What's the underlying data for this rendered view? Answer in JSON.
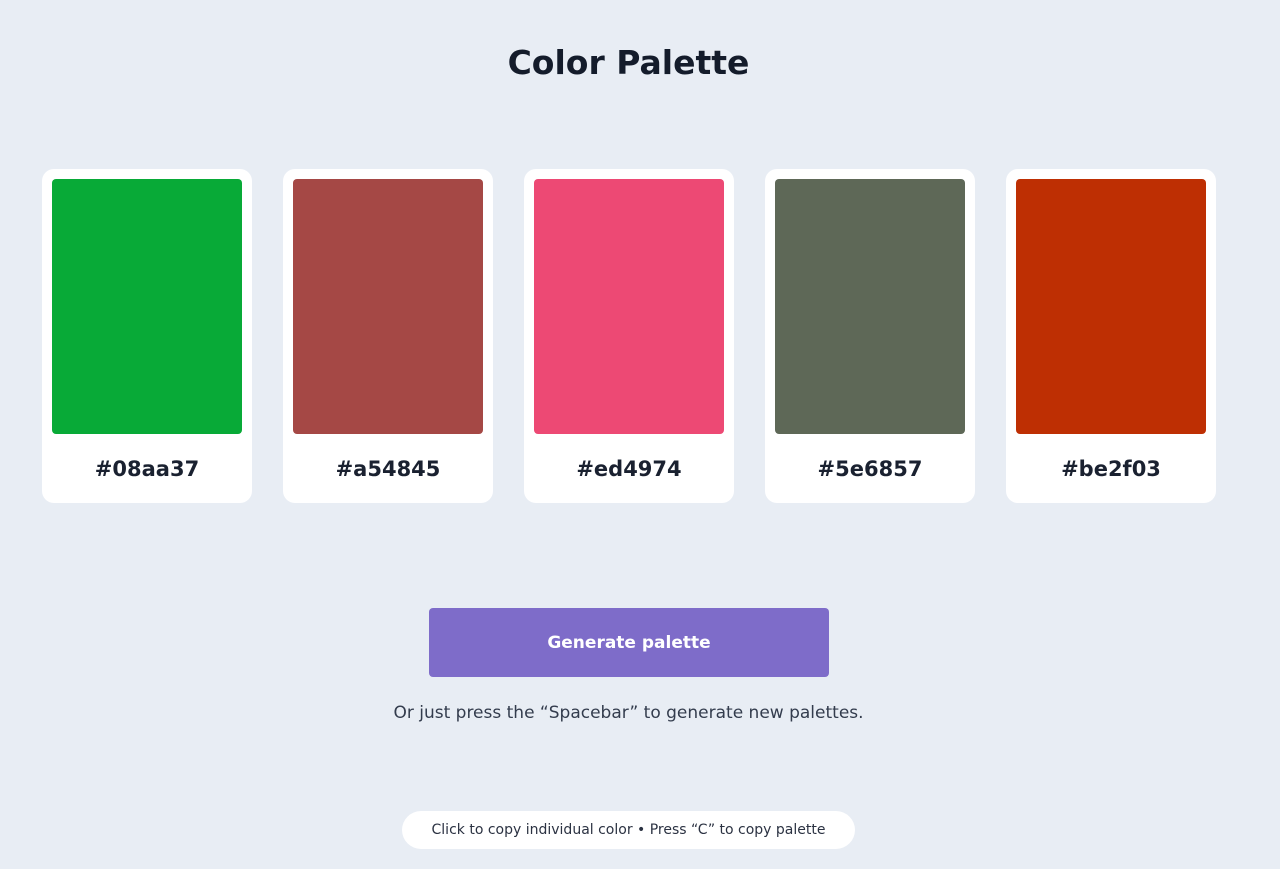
{
  "page": {
    "title": "Color Palette"
  },
  "palette": {
    "colors": [
      {
        "hex": "#08aa37"
      },
      {
        "hex": "#a54845"
      },
      {
        "hex": "#ed4974"
      },
      {
        "hex": "#5e6857"
      },
      {
        "hex": "#be2f03"
      }
    ]
  },
  "controls": {
    "generate_label": "Generate palette",
    "hint": "Or just press the “Spacebar” to generate new palettes."
  },
  "footer": {
    "tip": "Click to copy individual color • Press “C” to copy palette"
  },
  "theme": {
    "background": "#e8edf4",
    "button_color": "#7e6cc9",
    "card_background": "#ffffff"
  }
}
